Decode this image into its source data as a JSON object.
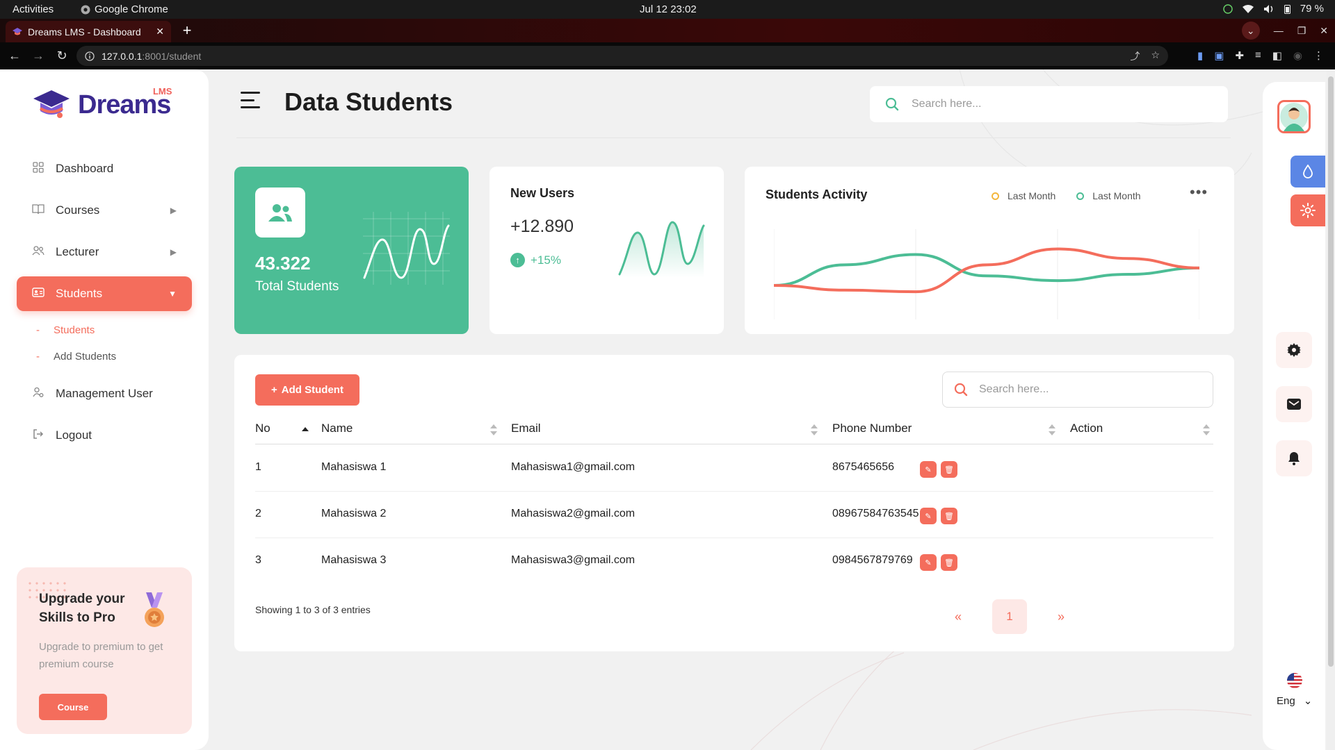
{
  "os_bar": {
    "activities": "Activities",
    "app_name": "Google Chrome",
    "clock": "Jul 12  23:02",
    "battery": "79 %"
  },
  "browser": {
    "tab_title": "Dreams LMS - Dashboard",
    "url_host": "127.0.0.1",
    "url_path": ":8001/student"
  },
  "brand": {
    "name": "Dreams",
    "sup": "LMS"
  },
  "sidebar": {
    "items": [
      {
        "label": "Dashboard"
      },
      {
        "label": "Courses"
      },
      {
        "label": "Lecturer"
      },
      {
        "label": "Students"
      },
      {
        "label": "Management User"
      },
      {
        "label": "Logout"
      }
    ],
    "submenu": [
      {
        "label": "Students"
      },
      {
        "label": "Add Students"
      }
    ],
    "dash": "-"
  },
  "upgrade": {
    "title": "Upgrade your Skills to Pro",
    "text": "Upgrade to premium to get premium course",
    "button": "Course"
  },
  "header": {
    "title": "Data Students",
    "search_placeholder": "Search here..."
  },
  "cards": {
    "total": {
      "value": "43.322",
      "label": "Total Students"
    },
    "new_users": {
      "title": "New Users",
      "value": "+12.890",
      "change": "+15%"
    },
    "activity": {
      "title": "Students Activity",
      "legend": [
        "Last Month",
        "Last Month"
      ],
      "more": "•••"
    }
  },
  "chart_data": {
    "type": "line",
    "title": "Students Activity",
    "series": [
      {
        "name": "Last Month",
        "color": "#4cbd95",
        "values": [
          0.36,
          0.62,
          0.75,
          0.48,
          0.42,
          0.5,
          0.58
        ]
      },
      {
        "name": "Last Month",
        "color": "#f46d5c",
        "values": [
          0.36,
          0.3,
          0.28,
          0.62,
          0.82,
          0.7,
          0.58
        ]
      }
    ],
    "x": [
      0,
      1,
      2,
      3,
      4,
      5,
      6
    ],
    "ylim": [
      0,
      1
    ],
    "grid": true
  },
  "table": {
    "add_button": "Add Student",
    "add_icon": "+",
    "search_placeholder": "Search here...",
    "columns": [
      "No",
      "Name",
      "Email",
      "Phone Number",
      "Action"
    ],
    "rows": [
      {
        "no": "1",
        "name": "Mahasiswa 1",
        "email": "Mahasiswa1@gmail.com",
        "phone": "8675465656"
      },
      {
        "no": "2",
        "name": "Mahasiswa 2",
        "email": "Mahasiswa2@gmail.com",
        "phone": "08967584763545"
      },
      {
        "no": "3",
        "name": "Mahasiswa 3",
        "email": "Mahasiswa3@gmail.com",
        "phone": "0984567879769"
      }
    ],
    "showing": "Showing 1 to 3 of 3 entries",
    "page": "1",
    "prev": "«",
    "next": "»"
  },
  "right_rail": {
    "language": "Eng"
  },
  "colors": {
    "accent": "#f46d5c",
    "green": "#4cbd95",
    "brand": "#3b2a8f",
    "blue": "#5b86e5"
  }
}
